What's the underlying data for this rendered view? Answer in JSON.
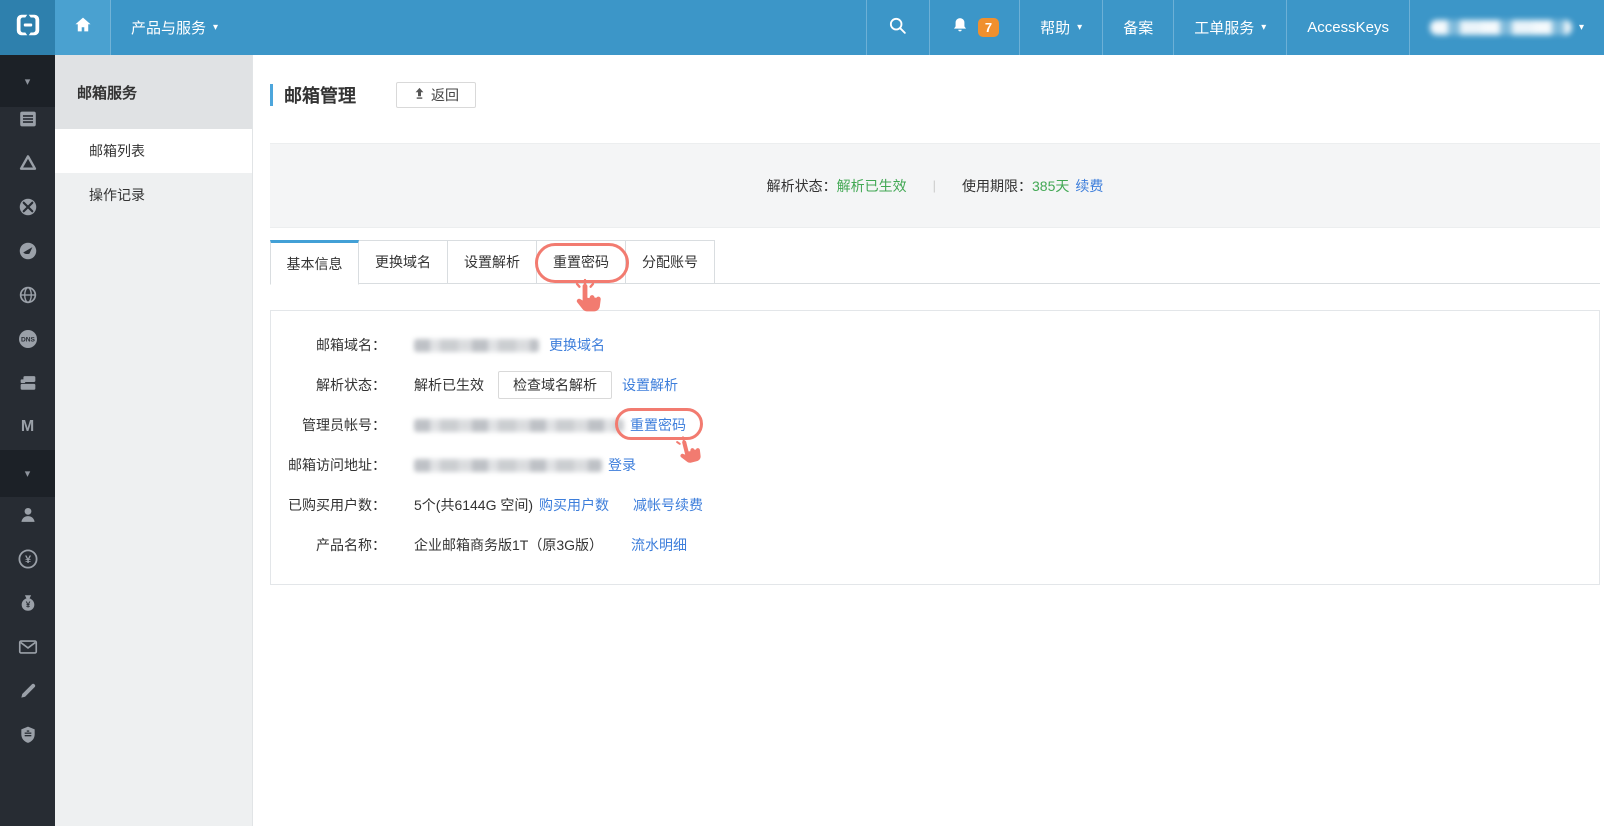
{
  "icons": {
    "caret_down": "▾",
    "dns": "DNS",
    "m": "M",
    "yen": "¥"
  },
  "colors": {
    "topbar_blue": "#3c96c8",
    "logo_cell": "#2e80ad",
    "rail_dark": "#272c33",
    "link_blue": "#3d7edb",
    "status_green": "#42a854",
    "annotation_red": "#f27b70",
    "badge_orange": "#f0902e"
  },
  "topbar": {
    "products_label": "产品与服务",
    "notification_count": "7",
    "help_label": "帮助",
    "beian_label": "备案",
    "ticket_label": "工单服务",
    "accesskeys_label": "AccessKeys"
  },
  "sidebar": {
    "title": "邮箱服务",
    "items": [
      {
        "label": "邮箱列表"
      },
      {
        "label": "操作记录"
      }
    ]
  },
  "main": {
    "page_title": "邮箱管理",
    "back_label": "返回",
    "status": {
      "resolve_label": "解析状态：",
      "resolve_value": "解析已生效",
      "divider": "|",
      "period_label": "使用期限：",
      "period_value": "385天",
      "renew_label": "续费"
    },
    "tabs": [
      {
        "label": "基本信息"
      },
      {
        "label": "更换域名"
      },
      {
        "label": "设置解析"
      },
      {
        "label": "重置密码"
      },
      {
        "label": "分配账号"
      }
    ],
    "rows": {
      "domain": {
        "label": "邮箱域名：",
        "link": "更换域名"
      },
      "resolve": {
        "label": "解析状态：",
        "value": "解析已生效",
        "button": "检查域名解析",
        "link": "设置解析"
      },
      "admin": {
        "label": "管理员帐号：",
        "link": "重置密码"
      },
      "url": {
        "label": "邮箱访问地址：",
        "link": "登录"
      },
      "users": {
        "label": "已购买用户数：",
        "value": "5个(共6144G 空间)",
        "link": "购买用户数",
        "link2": "减帐号续费"
      },
      "product": {
        "label": "产品名称：",
        "value": "企业邮箱商务版1T（原3G版）",
        "link": "流水明细"
      }
    }
  }
}
